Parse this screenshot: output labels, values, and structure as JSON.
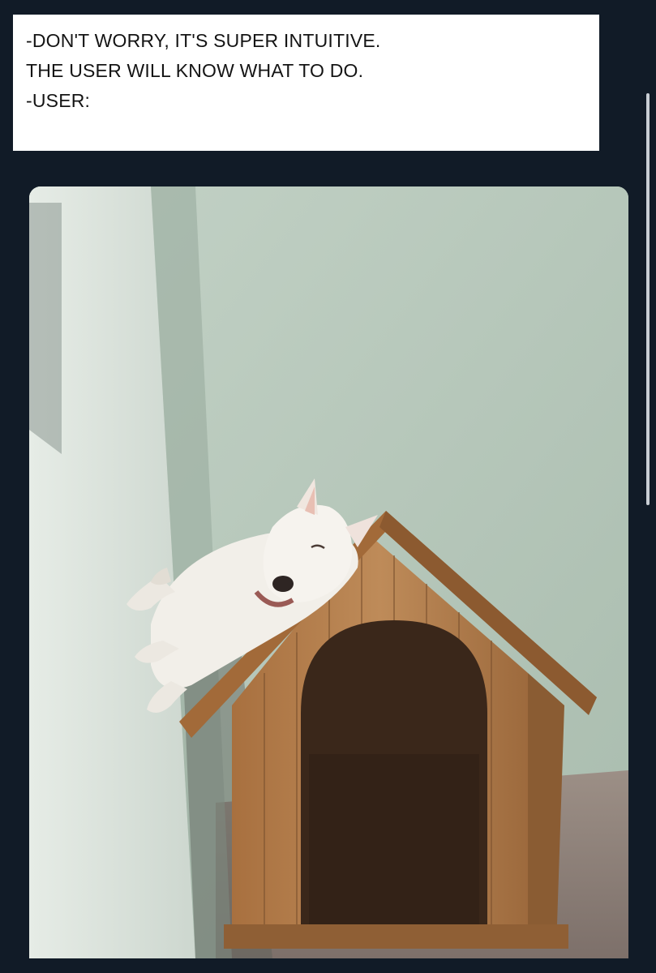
{
  "caption": {
    "lines": [
      "-DON'T WORRY, IT'S SUPER INTUITIVE.",
      "THE USER WILL KNOW WHAT TO DO.",
      "-USER:"
    ]
  },
  "colors": {
    "background": "#111b27",
    "caption_bg": "#ffffff",
    "wall": "#b7c8bb",
    "wood": "#b07a4a",
    "dog": "#f2efe9"
  },
  "photo": {
    "icons": [
      "dog-icon",
      "doghouse-icon"
    ]
  }
}
